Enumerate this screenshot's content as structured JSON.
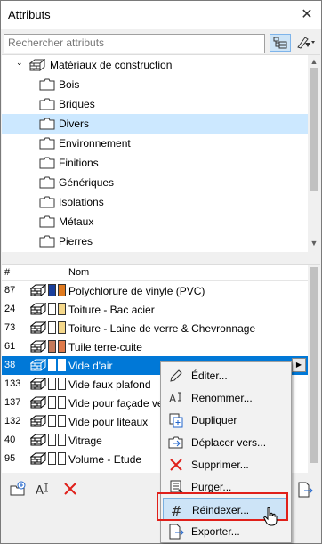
{
  "window": {
    "title": "Attributs",
    "close_icon": "close-icon"
  },
  "search": {
    "placeholder": "Rechercher attributs",
    "value": ""
  },
  "tree": {
    "parent": "Matériaux de construction",
    "items": [
      {
        "label": "Bois",
        "selected": false
      },
      {
        "label": "Briques",
        "selected": false
      },
      {
        "label": "Divers",
        "selected": true
      },
      {
        "label": "Environnement",
        "selected": false
      },
      {
        "label": "Finitions",
        "selected": false
      },
      {
        "label": "Génériques",
        "selected": false
      },
      {
        "label": "Isolations",
        "selected": false
      },
      {
        "label": "Métaux",
        "selected": false
      },
      {
        "label": "Pierres",
        "selected": false
      }
    ]
  },
  "list": {
    "header": {
      "index": "#",
      "name": "Nom"
    },
    "rows": [
      {
        "index": "87",
        "name": "Polychlorure de vinyle (PVC)",
        "swatch1": "#1a3f9b",
        "swatch2": "#e07a1f",
        "selected": false
      },
      {
        "index": "24",
        "name": "Toiture - Bac acier",
        "swatch1": "#ffffff",
        "swatch2": "#f5d88a",
        "selected": false
      },
      {
        "index": "73",
        "name": "Toiture - Laine de verre & Chevronnage",
        "swatch1": "#ffffff",
        "swatch2": "#f5d88a",
        "selected": false
      },
      {
        "index": "61",
        "name": "Tuile terre-cuite",
        "swatch1": "#c47a5a",
        "swatch2": "#e07a4a",
        "selected": false
      },
      {
        "index": "38",
        "name": "Vide d'air",
        "swatch1": "#ffffff",
        "swatch2": "#ffffff",
        "selected": true
      },
      {
        "index": "133",
        "name": "Vide faux plafond",
        "swatch1": "#ffffff",
        "swatch2": "#ffffff",
        "selected": false
      },
      {
        "index": "137",
        "name": "Vide pour façade ver",
        "swatch1": "#ffffff",
        "swatch2": "#ffffff",
        "selected": false
      },
      {
        "index": "132",
        "name": "Vide pour liteaux",
        "swatch1": "#ffffff",
        "swatch2": "#ffffff",
        "selected": false
      },
      {
        "index": "40",
        "name": "Vitrage",
        "swatch1": "#ffffff",
        "swatch2": "#ffffff",
        "selected": false
      },
      {
        "index": "95",
        "name": "Volume - Etude",
        "swatch1": "#ffffff",
        "swatch2": "#ffffff",
        "selected": false
      }
    ]
  },
  "context_menu": {
    "items": [
      {
        "label": "Éditer...",
        "icon": "pencil-icon"
      },
      {
        "label": "Renommer...",
        "icon": "rename-icon"
      },
      {
        "label": "Dupliquer",
        "icon": "duplicate-icon"
      },
      {
        "label": "Déplacer vers...",
        "icon": "move-folder-icon"
      },
      {
        "label": "Supprimer...",
        "icon": "delete-x-icon"
      },
      {
        "label": "Purger...",
        "icon": "purge-icon"
      },
      {
        "label": "Réindexer...",
        "icon": "hash-icon",
        "highlighted": true
      },
      {
        "label": "Exporter...",
        "icon": "export-icon"
      }
    ]
  },
  "colors": {
    "selection": "#0078d7",
    "tree_selection": "#cce8ff",
    "highlight_outline": "#e0201a",
    "delete_red": "#e0201a"
  }
}
